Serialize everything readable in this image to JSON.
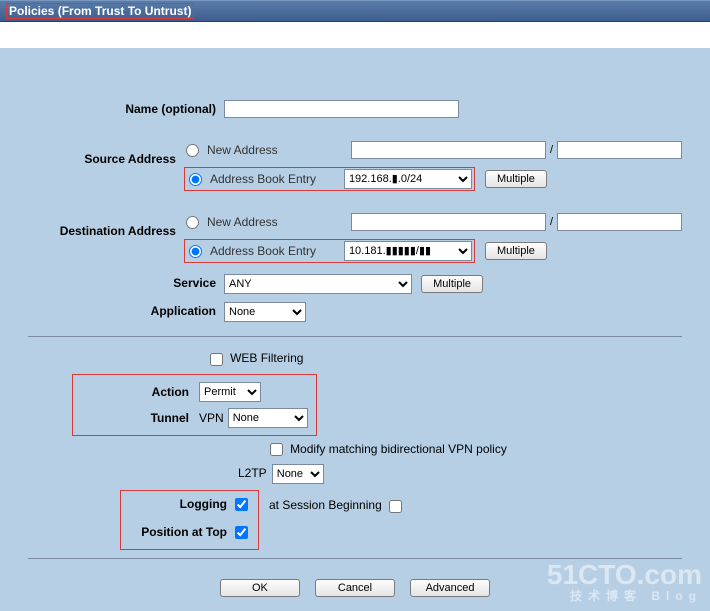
{
  "header": {
    "title": "Policies (From Trust To Untrust)"
  },
  "labels": {
    "name": "Name (optional)",
    "source": "Source Address",
    "destination": "Destination Address",
    "service": "Service",
    "application": "Application",
    "webfilter": "WEB Filtering",
    "action": "Action",
    "tunnel": "Tunnel",
    "vpn": "VPN",
    "modify_vpn": "Modify matching bidirectional VPN policy",
    "l2tp": "L2TP",
    "logging": "Logging",
    "at_session": "at Session Beginning",
    "position_top": "Position at Top"
  },
  "radio": {
    "new_address": "New Address",
    "addr_book": "Address Book Entry"
  },
  "values": {
    "name": "",
    "src_new1": "",
    "src_new2": "",
    "src_book": "192.168.▮.0/24",
    "dst_new1": "",
    "dst_new2": "",
    "dst_book": "10.181.▮▮▮▮▮/▮▮",
    "service": "ANY",
    "application": "None",
    "action": "Permit",
    "vpn": "None",
    "l2tp": "None",
    "logging": true,
    "position_top": true
  },
  "buttons": {
    "multiple": "Multiple",
    "ok": "OK",
    "cancel": "Cancel",
    "advanced": "Advanced"
  },
  "watermark": {
    "main": "51CTO.com",
    "sub": "技术博客  Blog"
  }
}
